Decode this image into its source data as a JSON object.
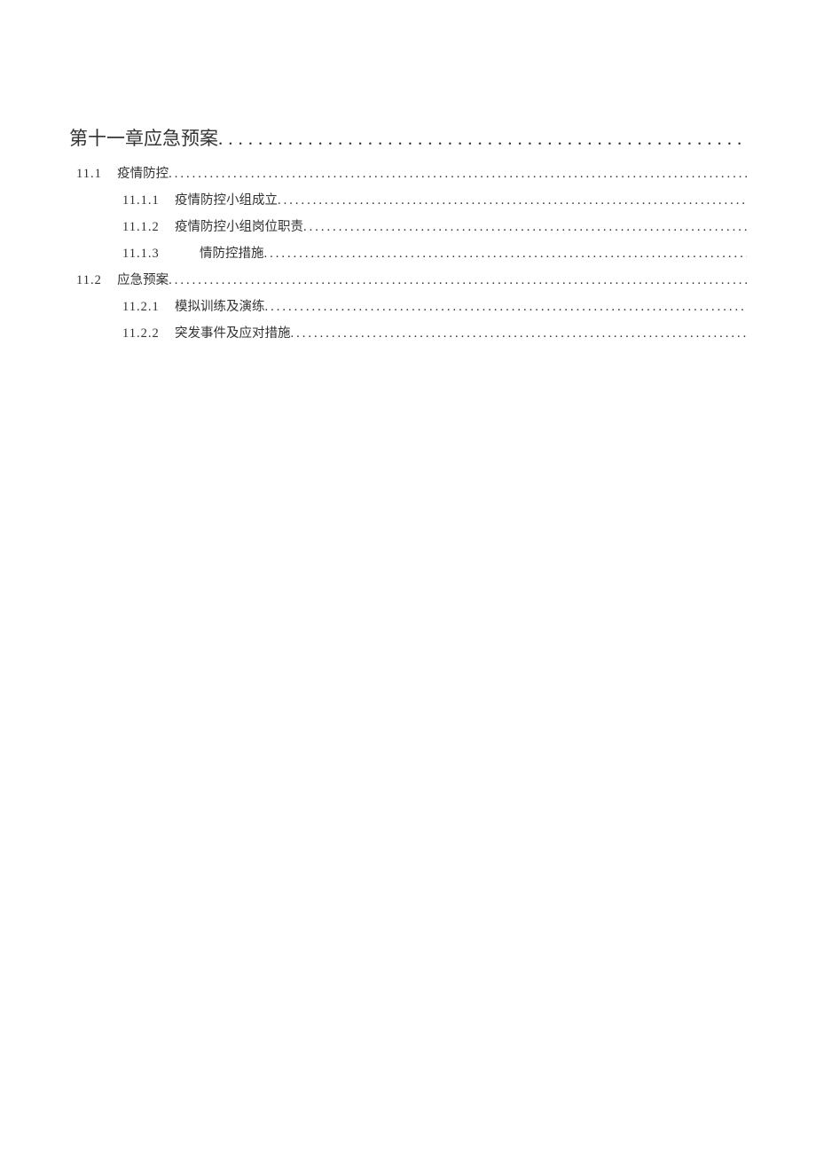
{
  "toc": {
    "chapter": {
      "label": "第十一章应急预案"
    },
    "entries": [
      {
        "level": 1,
        "num": "11.1",
        "title": "疫情防控"
      },
      {
        "level": 2,
        "num": "11.1.1",
        "title": "疫情防控小组成立"
      },
      {
        "level": 2,
        "num": "11.1.2",
        "title": "疫情防控小组岗位职责"
      },
      {
        "level": 2,
        "num": "11.1.3",
        "title": "情防控措施",
        "wide_gap": true
      },
      {
        "level": 1,
        "num": "11.2",
        "title": "应急预案"
      },
      {
        "level": 2,
        "num": "11.2.1",
        "title": "模拟训练及演练"
      },
      {
        "level": 2,
        "num": "11.2.2",
        "title": "突发事件及应对措施"
      }
    ]
  }
}
